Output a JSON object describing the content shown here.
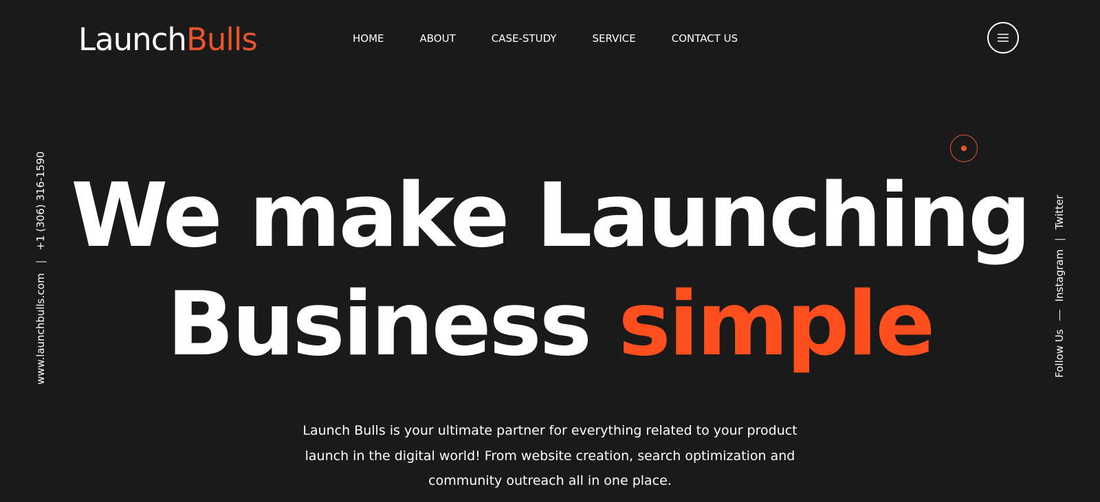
{
  "brand": {
    "name_part1": "Launch",
    "name_part2": "Bulls",
    "accent_color": "#e8542c"
  },
  "nav": {
    "items": [
      "HOME",
      "ABOUT",
      "CASE-STUDY",
      "SERVICE",
      "CONTACT US"
    ]
  },
  "menu_button": {
    "icon": "hamburger-icon"
  },
  "left_rail": {
    "website": "www.launchbulls.com",
    "separator": "|",
    "phone": "+1 (306) 316-1590"
  },
  "right_rail": {
    "follow_label": "Follow Us",
    "socials": [
      "Instagram",
      "Twitter"
    ],
    "separator": "|"
  },
  "hero": {
    "line1": "We make Launching",
    "line2_plain": "Business",
    "line2_accent": "simple",
    "accent_color": "#ff4f1f",
    "description": "Launch Bulls is your ultimate partner for everything related to your product launch in the digital world! From website creation, search optimization and community outreach all in one place."
  },
  "colors": {
    "background": "#1a1a1a",
    "text": "#ffffff"
  }
}
